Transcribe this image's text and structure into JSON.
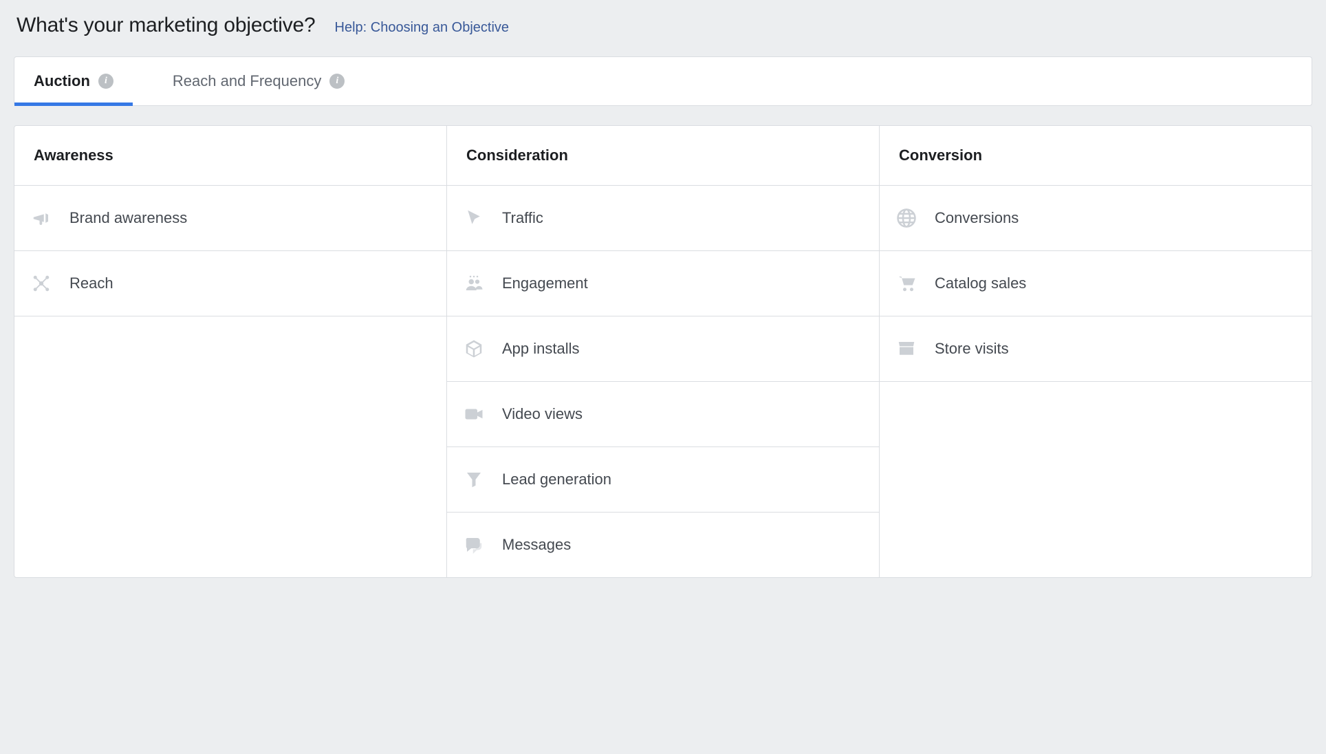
{
  "title": "What's your marketing objective?",
  "help_link": "Help: Choosing an Objective",
  "tabs": [
    {
      "label": "Auction",
      "active": true
    },
    {
      "label": "Reach and Frequency",
      "active": false
    }
  ],
  "columns": [
    {
      "header": "Awareness",
      "options": [
        {
          "label": "Brand awareness",
          "icon": "megaphone"
        },
        {
          "label": "Reach",
          "icon": "network"
        }
      ]
    },
    {
      "header": "Consideration",
      "options": [
        {
          "label": "Traffic",
          "icon": "cursor"
        },
        {
          "label": "Engagement",
          "icon": "people"
        },
        {
          "label": "App installs",
          "icon": "box"
        },
        {
          "label": "Video views",
          "icon": "video"
        },
        {
          "label": "Lead generation",
          "icon": "funnel"
        },
        {
          "label": "Messages",
          "icon": "chat"
        }
      ]
    },
    {
      "header": "Conversion",
      "options": [
        {
          "label": "Conversions",
          "icon": "globe"
        },
        {
          "label": "Catalog sales",
          "icon": "cart"
        },
        {
          "label": "Store visits",
          "icon": "store"
        }
      ]
    }
  ]
}
